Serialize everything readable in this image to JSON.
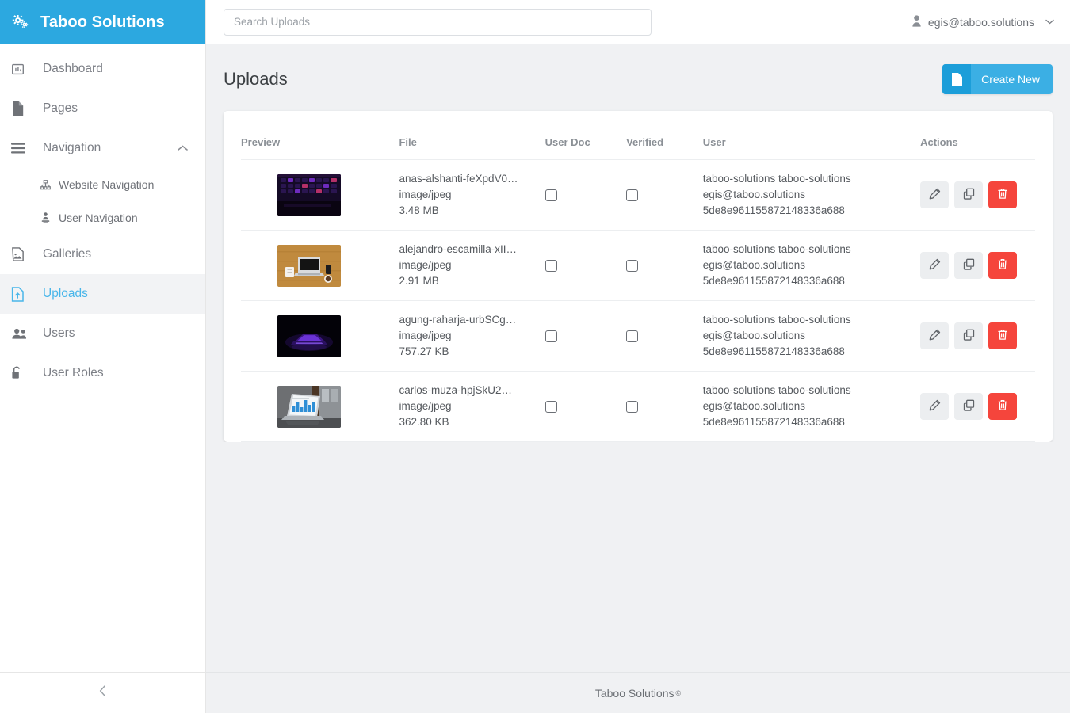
{
  "brand": {
    "title": "Taboo Solutions",
    "icon": "cogs-icon",
    "color": "#2CA8E0"
  },
  "sidebar": {
    "items": [
      {
        "label": "Dashboard",
        "icon": "dashboard-icon",
        "active": false
      },
      {
        "label": "Pages",
        "icon": "file-icon",
        "active": false
      },
      {
        "label": "Navigation",
        "icon": "bars-icon",
        "active": false,
        "expanded": true
      },
      {
        "label": "Galleries",
        "icon": "image-icon",
        "active": false
      },
      {
        "label": "Uploads",
        "icon": "file-upload-icon",
        "active": true
      },
      {
        "label": "Users",
        "icon": "users-icon",
        "active": false
      },
      {
        "label": "User Roles",
        "icon": "unlock-icon",
        "active": false
      }
    ],
    "sub_items": [
      {
        "label": "Website Navigation",
        "icon": "sitemap-icon"
      },
      {
        "label": "User Navigation",
        "icon": "user-pin-icon"
      }
    ],
    "collapse_icon": "chevron-left-icon"
  },
  "topbar": {
    "search_placeholder": "Search Uploads",
    "search_value": "",
    "user_email": "egis@taboo.solutions",
    "user_icon": "user-icon",
    "caret_icon": "chevron-down-icon"
  },
  "page": {
    "title": "Uploads",
    "create_button": {
      "label": "Create New",
      "icon": "file-icon"
    }
  },
  "table": {
    "columns": [
      "Preview",
      "File",
      "User Doc",
      "Verified",
      "User",
      "Actions"
    ],
    "rows": [
      {
        "thumb": "keyboard-rgb-dark",
        "file_name": "anas-alshanti-feXpdV0…",
        "mime": "image/jpeg",
        "size": "3.48 MB",
        "user_doc": false,
        "verified": false,
        "user_name": "taboo-solutions taboo-solutions",
        "user_email": "egis@taboo.solutions",
        "user_id": "5de8e961155872148336a688"
      },
      {
        "thumb": "desk-laptop-wood",
        "file_name": "alejandro-escamilla-xII…",
        "mime": "image/jpeg",
        "size": "2.91 MB",
        "user_doc": false,
        "verified": false,
        "user_name": "taboo-solutions taboo-solutions",
        "user_email": "egis@taboo.solutions",
        "user_id": "5de8e961155872148336a688"
      },
      {
        "thumb": "laptop-glow-dark",
        "file_name": "agung-raharja-urbSCg…",
        "mime": "image/jpeg",
        "size": "757.27 KB",
        "user_doc": false,
        "verified": false,
        "user_name": "taboo-solutions taboo-solutions",
        "user_email": "egis@taboo.solutions",
        "user_id": "5de8e961155872148336a688"
      },
      {
        "thumb": "laptop-charts-window",
        "file_name": "carlos-muza-hpjSkU2…",
        "mime": "image/jpeg",
        "size": "362.80 KB",
        "user_doc": false,
        "verified": false,
        "user_name": "taboo-solutions taboo-solutions",
        "user_email": "egis@taboo.solutions",
        "user_id": "5de8e961155872148336a688"
      }
    ],
    "row_actions": [
      {
        "name": "edit",
        "icon": "pencil-icon"
      },
      {
        "name": "duplicate",
        "icon": "copy-icon"
      },
      {
        "name": "delete",
        "icon": "trash-icon",
        "color": "#F5453C"
      }
    ]
  },
  "footer": {
    "text": "Taboo Solutions",
    "mark": "©"
  }
}
